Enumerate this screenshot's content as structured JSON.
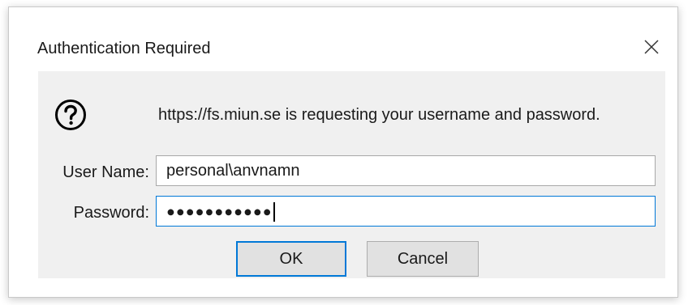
{
  "dialog": {
    "title": "Authentication Required",
    "close_icon": "close-icon",
    "prompt_icon": "question-icon",
    "message": "https://fs.miun.se is requesting your username and password.",
    "username": {
      "label": "User Name:",
      "value": "personal\\anvnamn"
    },
    "password": {
      "label": "Password:",
      "masked_value": "●●●●●●●●●●●"
    },
    "ok_label": "OK",
    "cancel_label": "Cancel"
  },
  "colors": {
    "focus_border": "#0078d7",
    "panel_background": "#f0f0f0",
    "button_background": "#e1e1e1"
  }
}
